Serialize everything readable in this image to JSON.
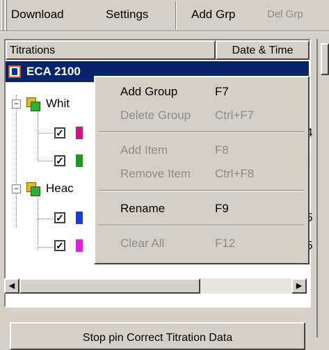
{
  "toolbar": {
    "download": "Download",
    "settings": "Settings",
    "add_grp": "Add Grp",
    "del_grp": "Del Grp"
  },
  "tree": {
    "col_titrations": "Titrations",
    "col_date": "Date & Time",
    "root": "ECA 2100",
    "group1": "Whit",
    "group2": "Heac",
    "partial_dates": [
      "4",
      "(",
      "5",
      "5"
    ]
  },
  "menu": {
    "items": [
      {
        "label": "Add Group",
        "key": "F7",
        "enabled": true
      },
      {
        "label": "Delete Group",
        "key": "Ctrl+F7",
        "enabled": false
      },
      {
        "label": "Add Item",
        "key": "F8",
        "enabled": false
      },
      {
        "label": "Remove Item",
        "key": "Ctrl+F8",
        "enabled": false
      },
      {
        "label": "Rename",
        "key": "F9",
        "enabled": true
      },
      {
        "label": "Clear All",
        "key": "F12",
        "enabled": false
      }
    ]
  },
  "bottom": {
    "button_label": "Stop pin Correct Titration Data"
  },
  "colors": {
    "selection": "#0a246a",
    "face": "#d4d0c8",
    "item_colors": [
      "#d4147a",
      "#1a9a1a",
      "#1a3cdc",
      "#e21ce2"
    ]
  }
}
